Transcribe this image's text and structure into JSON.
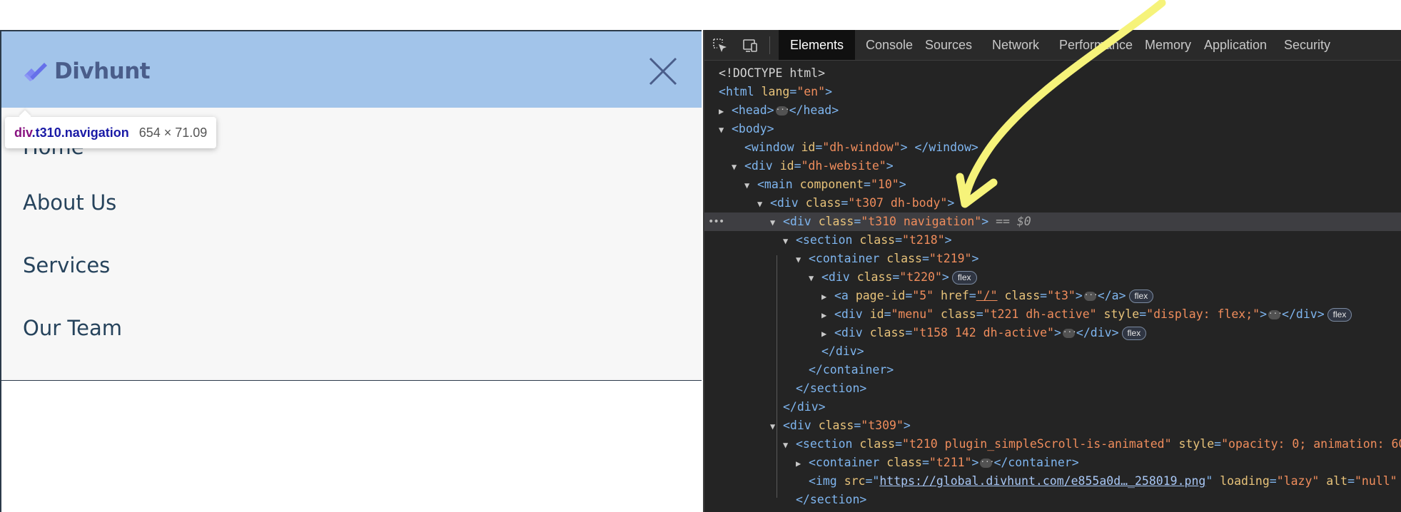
{
  "preview": {
    "logo_text": "Divhunt",
    "menu": [
      "Home",
      "About Us",
      "Services",
      "Our Team"
    ],
    "tooltip": {
      "tag": "div",
      "classes": ".t310.navigation",
      "size": "654 × 71.09"
    },
    "colors": {
      "header_bg": "#a2c4ea",
      "menu_bg": "#f7f7f7",
      "text": "#26435c",
      "logo": "#4a5d8a"
    }
  },
  "devtools": {
    "icons": [
      "inspect-element-icon",
      "device-toolbar-icon"
    ],
    "tabs": [
      "Elements",
      "Console",
      "Sources",
      "Network",
      "Performance",
      "Memory",
      "Application",
      "Security"
    ],
    "active_tab": "Elements",
    "tree": {
      "doctype": "<!DOCTYPE html>",
      "html_tag": "html",
      "lang_attr": "lang",
      "lang_val": "\"en\"",
      "head_open": "<head>",
      "head_close": "</head>",
      "body": "<body>",
      "window_tag": "<window",
      "window_attr": "id",
      "window_val": "\"dh-window\"",
      "window_close": "> </window>",
      "div_website": "<div",
      "website_attr": "id",
      "website_val": "\"dh-website\"",
      "main_tag": "<main",
      "main_attr": "component",
      "main_val": "\"10\"",
      "div_body": "<div",
      "body_attr": "class",
      "body_val": "\"t307 dh-body\"",
      "sel_tag": "<div",
      "sel_attr": "class",
      "sel_val": "\"t310 navigation\"",
      "sel_suffix": "== $0",
      "section_tag": "<section",
      "section_attr": "class",
      "section_val": "\"t218\"",
      "container_tag": "<container",
      "container_attr": "class",
      "container_val": "\"t219\"",
      "t220_tag": "<div",
      "t220_attr": "class",
      "t220_val": "\"t220\"",
      "a_tag": "<a",
      "a_attr1": "page-id",
      "a_val1": "\"5\"",
      "a_attr2": "href",
      "a_val2": "\"/\"",
      "a_attr3": "class",
      "a_val3": "\"t3\"",
      "a_close": "</a>",
      "menu_tag": "<div",
      "menu_attr1": "id",
      "menu_val1": "\"menu\"",
      "menu_attr2": "class",
      "menu_val2": "\"t221 dh-active\"",
      "menu_attr3": "style",
      "menu_val3": "\"display: flex;\"",
      "menu_close": "</div>",
      "t158_tag": "<div",
      "t158_attr": "class",
      "t158_val": "\"t158 142 dh-active\"",
      "t158_close": "</div>",
      "close_div": "</div>",
      "close_container": "</container>",
      "close_section": "</section>",
      "close_div2": "</div>",
      "t309_tag": "<div",
      "t309_attr": "class",
      "t309_val": "\"t309\"",
      "s210_tag": "<section",
      "s210_attr1": "class",
      "s210_val1": "\"t210 plugin_simpleScroll-is-animated\"",
      "s210_attr2": "style",
      "s210_val2": "\"opacity: 0; animation: 60",
      "c211_tag": "<container",
      "c211_attr": "class",
      "c211_val": "\"t211\"",
      "c211_close": "</container>",
      "img_tag": "<img",
      "img_attr1": "src",
      "img_link": "https://global.divhunt.com/e855a0d…_258019.png",
      "img_attr2": "loading",
      "img_val2": "\"lazy\"",
      "img_attr3": "alt",
      "img_val3": "\"null\"",
      "close_section2": "</section>",
      "flex_badge": "flex"
    },
    "colors": {
      "bg": "#242424",
      "tag": "#7fb6f0",
      "attr": "#e8c37a",
      "value": "#f08d5c"
    }
  },
  "annotation": {
    "type": "yellow-arrow",
    "color": "#f6f37a"
  }
}
